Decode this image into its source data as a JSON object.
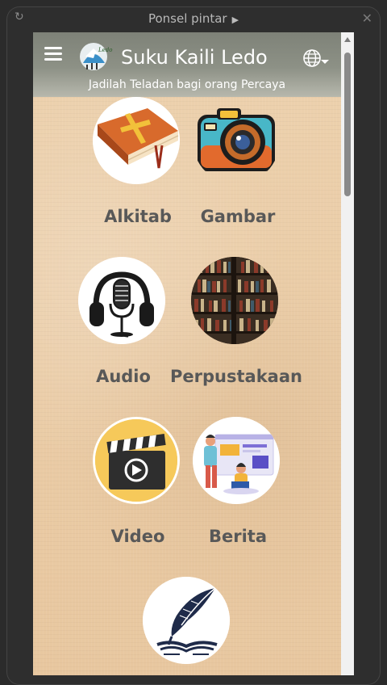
{
  "window": {
    "title": "Ponsel pintar"
  },
  "header": {
    "title": "Suku Kaili Ledo",
    "subtitle": "Jadilah Teladan bagi orang Percaya"
  },
  "menu": {
    "items": [
      {
        "label": "Alkitab",
        "icon": "bible-icon"
      },
      {
        "label": "Gambar",
        "icon": "camera-icon"
      },
      {
        "label": "Audio",
        "icon": "headphones-microphone-icon"
      },
      {
        "label": "Perpustakaan",
        "icon": "bookshelf-icon"
      },
      {
        "label": "Video",
        "icon": "clapperboard-icon"
      },
      {
        "label": "Berita",
        "icon": "news-people-icon"
      },
      {
        "label": "",
        "icon": "quill-book-icon"
      }
    ]
  },
  "colors": {
    "background": "#eac9a2",
    "header_top": "#7e8278",
    "header_bottom": "#b7b8ad",
    "label": "#585858"
  }
}
